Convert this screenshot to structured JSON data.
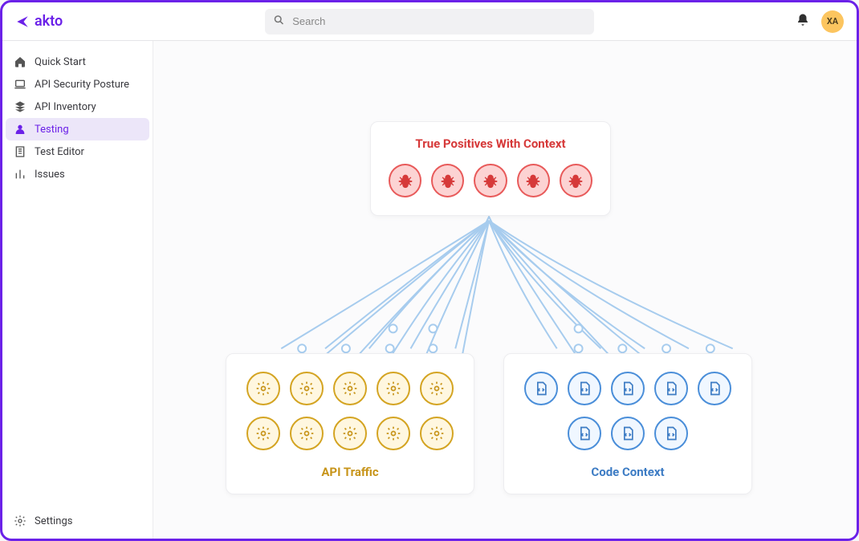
{
  "brand": "akto",
  "search": {
    "placeholder": "Search"
  },
  "user": {
    "initials": "XA"
  },
  "sidebar": {
    "items": [
      {
        "label": "Quick Start",
        "icon": "home"
      },
      {
        "label": "API Security Posture",
        "icon": "laptop"
      },
      {
        "label": "API Inventory",
        "icon": "layers"
      },
      {
        "label": "Testing",
        "icon": "user",
        "active": true
      },
      {
        "label": "Test Editor",
        "icon": "building"
      },
      {
        "label": "Issues",
        "icon": "bars"
      }
    ],
    "footer": {
      "label": "Settings",
      "icon": "gear"
    }
  },
  "diagram": {
    "top_card": {
      "title": "True Positives With Context",
      "bug_count": 5
    },
    "left_card": {
      "title": "API Traffic",
      "rows": [
        5,
        5
      ]
    },
    "right_card": {
      "title": "Code Context",
      "rows": [
        5,
        3
      ]
    }
  }
}
